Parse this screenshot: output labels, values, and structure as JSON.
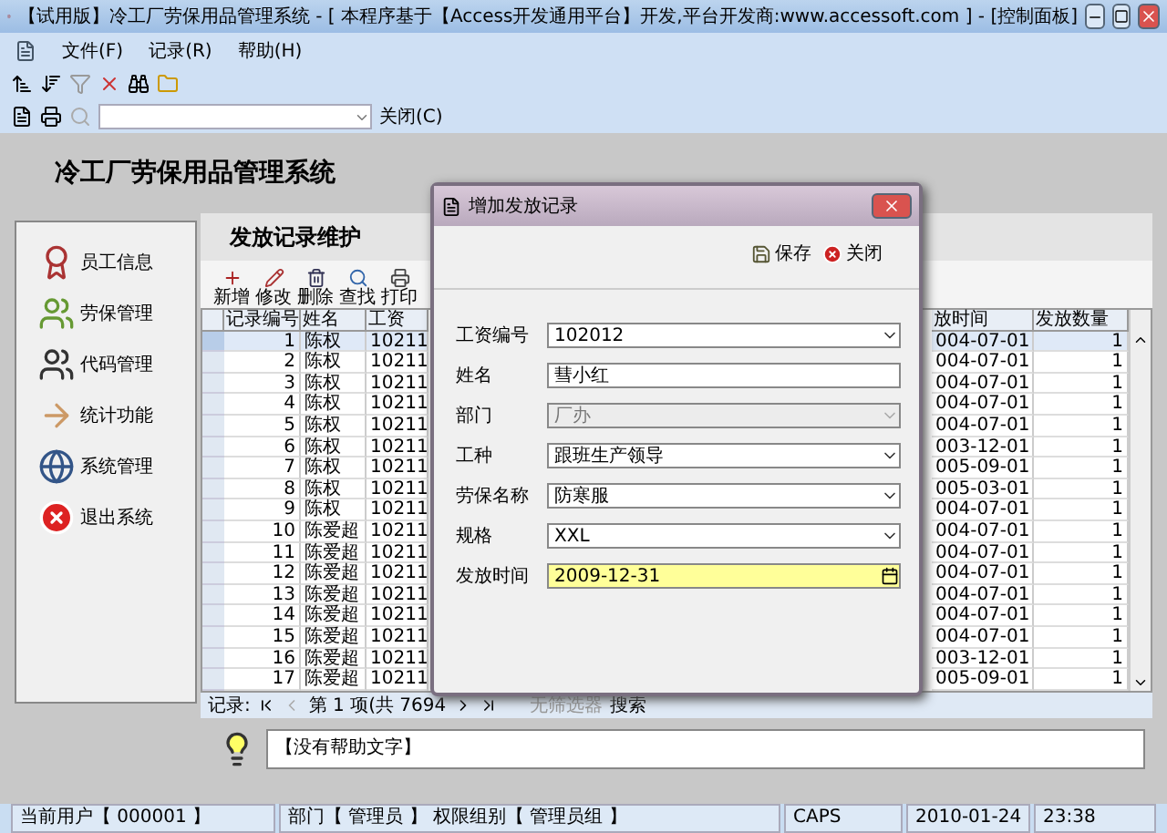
{
  "window": {
    "title": "【试用版】冷工厂劳保用品管理系统 - [ 本程序基于【Access开发通用平台】开发,平台开发商:www.accessoft.com ] - [控制面板]"
  },
  "menu": [
    "文件(F)",
    "记录(R)",
    "帮助(H)"
  ],
  "toolbar2": {
    "close": "关闭(C)"
  },
  "app_title": "冷工厂劳保用品管理系统",
  "sidebar": {
    "items": [
      {
        "label": "员工信息",
        "kind": "certificate"
      },
      {
        "label": "劳保管理",
        "kind": "balls"
      },
      {
        "label": "代码管理",
        "kind": "people"
      },
      {
        "label": "统计功能",
        "kind": "arrow"
      },
      {
        "label": "系统管理",
        "kind": "globe"
      },
      {
        "label": "退出系统",
        "kind": "exit"
      }
    ]
  },
  "panel": {
    "title": "发放记录维护",
    "actions": [
      {
        "label": "新增",
        "kind": "add"
      },
      {
        "label": "修改",
        "kind": "edit"
      },
      {
        "label": "删除",
        "kind": "delete"
      },
      {
        "label": "查找",
        "kind": "find"
      },
      {
        "label": "打印",
        "kind": "print"
      }
    ],
    "table": {
      "columns": [
        "记录编号",
        "姓名",
        "工资",
        "放时间",
        "发放数量"
      ],
      "rows": [
        {
          "cells": [
            "1",
            "陈权",
            "10211",
            "004-07-01",
            "1"
          ],
          "selected": true
        },
        {
          "cells": [
            "2",
            "陈权",
            "10211",
            "004-07-01",
            "1"
          ],
          "selected": false
        },
        {
          "cells": [
            "3",
            "陈权",
            "10211",
            "004-07-01",
            "1"
          ],
          "selected": false
        },
        {
          "cells": [
            "4",
            "陈权",
            "10211",
            "004-07-01",
            "1"
          ],
          "selected": false
        },
        {
          "cells": [
            "5",
            "陈权",
            "10211",
            "004-07-01",
            "1"
          ],
          "selected": false
        },
        {
          "cells": [
            "6",
            "陈权",
            "10211",
            "003-12-01",
            "1"
          ],
          "selected": false
        },
        {
          "cells": [
            "7",
            "陈权",
            "10211",
            "005-09-01",
            "1"
          ],
          "selected": false
        },
        {
          "cells": [
            "8",
            "陈权",
            "10211",
            "005-03-01",
            "1"
          ],
          "selected": false
        },
        {
          "cells": [
            "9",
            "陈权",
            "10211",
            "004-07-01",
            "1"
          ],
          "selected": false
        },
        {
          "cells": [
            "10",
            "陈爱超",
            "10211",
            "004-07-01",
            "1"
          ],
          "selected": false
        },
        {
          "cells": [
            "11",
            "陈爱超",
            "10211",
            "004-07-01",
            "1"
          ],
          "selected": false
        },
        {
          "cells": [
            "12",
            "陈爱超",
            "10211",
            "004-07-01",
            "1"
          ],
          "selected": false
        },
        {
          "cells": [
            "13",
            "陈爱超",
            "10211",
            "004-07-01",
            "1"
          ],
          "selected": false
        },
        {
          "cells": [
            "14",
            "陈爱超",
            "10211",
            "004-07-01",
            "1"
          ],
          "selected": false
        },
        {
          "cells": [
            "15",
            "陈爱超",
            "10211",
            "004-07-01",
            "1"
          ],
          "selected": false
        },
        {
          "cells": [
            "16",
            "陈爱超",
            "10211",
            "003-12-01",
            "1"
          ],
          "selected": false
        },
        {
          "cells": [
            "17",
            "陈爱超",
            "10211",
            "005-09-01",
            "1"
          ],
          "selected": false
        }
      ]
    },
    "navigator": {
      "label": "记录:",
      "position": "第 1 项(共 7694",
      "filter": "无筛选器",
      "search": "搜索"
    }
  },
  "help": "【没有帮助文字】",
  "status_bar": [
    "当前用户【 000001 】",
    "部门【 管理员 】 权限组别【 管理员组 】",
    "CAPS",
    "2010-01-24",
    "23:38"
  ],
  "dialog": {
    "title": "增加发放记录",
    "buttons": [
      {
        "label": "保存",
        "kind": "save"
      },
      {
        "label": "关闭",
        "kind": "close"
      }
    ],
    "fields": [
      {
        "label": "工资编号",
        "value": "102012",
        "kind": "combo",
        "disabled": false
      },
      {
        "label": "姓名",
        "value": "彗小红",
        "kind": "text",
        "disabled": false
      },
      {
        "label": "部门",
        "value": "厂办",
        "kind": "combo",
        "disabled": true
      },
      {
        "label": "工种",
        "value": "跟班生产领导",
        "kind": "combo",
        "disabled": false
      },
      {
        "label": "劳保名称",
        "value": "防寒服",
        "kind": "combo",
        "disabled": false
      },
      {
        "label": "规格",
        "value": "XXL",
        "kind": "combo",
        "disabled": false
      },
      {
        "label": "发放时间",
        "value": "2009-12-31",
        "kind": "date",
        "disabled": false
      }
    ]
  }
}
